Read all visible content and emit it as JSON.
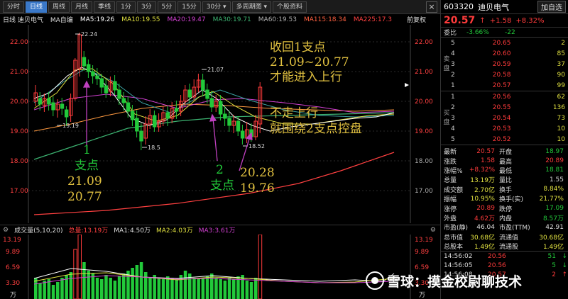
{
  "toolbar": {
    "buttons": [
      "分时",
      "日线",
      "周线",
      "月线",
      "季线",
      "1分",
      "3分",
      "5分",
      "15分",
      "30分 ▾",
      "多周期图 ▾",
      "个股资料"
    ],
    "active_index": 1,
    "close_label": "×"
  },
  "indicators": {
    "period": "日线 迪贝电气",
    "ma_label": "MA自编",
    "ma5": "MA5:19.26",
    "ma10": "MA10:19.55",
    "ma20": "MA20:19.47",
    "ma30": "MA30:19.71",
    "ma60": "MA60:19.53",
    "ma115": "MA115:18.34",
    "ma225": "MA225:17.3",
    "restore": "前复权"
  },
  "price_axis": [
    "22.00",
    "21.00",
    "20.00",
    "19.00",
    "18.00",
    "17.00"
  ],
  "price_axis_right": [
    "22.00",
    "21.00",
    "20.00",
    "19.00",
    "18.00",
    "17.00"
  ],
  "markers": {
    "high_peak": "22.24",
    "peak2": "21.07",
    "low1": "19.19",
    "low2": "18.5",
    "low3": "18.52"
  },
  "annotations": {
    "top_right": [
      "收回1支点",
      "21.09~20.77",
      "才能进入上行"
    ],
    "mid_right": [
      "不走上行",
      "就围绕2支点控盘"
    ],
    "sp1": [
      "1",
      "支点",
      "21.09",
      "20.77"
    ],
    "sp2_num": "2",
    "sp2_lbl": "支点",
    "sp2_vals": [
      "20.28",
      "19.76"
    ]
  },
  "volume": {
    "title": "成交量(5,10,20)",
    "total": "总量:13.19万",
    "ma1": "MA1:4.50万",
    "ma2": "MA2:4.03万",
    "ma3": "MA3:3.61万",
    "axis": [
      "13.19",
      "9.89",
      "6.59",
      "3.30",
      "万"
    ]
  },
  "right_panel": {
    "code": "603320",
    "name": "迪贝电气",
    "add_label": "加自选",
    "price": "20.57",
    "arrow": "↑",
    "change": "+1.58",
    "change_pct": "+8.32%",
    "weibi_label": "委比",
    "weibi_pct": "-3.66%",
    "weicha": "-22",
    "sell_label": "卖盘",
    "buy_label": "买盘",
    "sells": [
      {
        "n": "5",
        "p": "20.65",
        "v": "2"
      },
      {
        "n": "4",
        "p": "20.60",
        "v": "85"
      },
      {
        "n": "3",
        "p": "20.59",
        "v": "37"
      },
      {
        "n": "2",
        "p": "20.58",
        "v": "90"
      },
      {
        "n": "1",
        "p": "20.57",
        "v": "99"
      }
    ],
    "buys": [
      {
        "n": "1",
        "p": "20.56",
        "v": "62"
      },
      {
        "n": "2",
        "p": "20.55",
        "v": "136"
      },
      {
        "n": "3",
        "p": "20.54",
        "v": "73"
      },
      {
        "n": "4",
        "p": "20.53",
        "v": "10"
      },
      {
        "n": "5",
        "p": "20.52",
        "v": "10"
      }
    ],
    "stats": [
      {
        "l1": "最新",
        "v1": "20.57",
        "c1": "red",
        "l2": "开盘",
        "v2": "18.97",
        "c2": "green"
      },
      {
        "l1": "涨跌",
        "v1": "1.58",
        "c1": "red",
        "l2": "最高",
        "v2": "20.89",
        "c2": "red"
      },
      {
        "l1": "涨幅%",
        "v1": "+8.32%",
        "c1": "red",
        "l2": "最低",
        "v2": "18.81",
        "c2": "green"
      },
      {
        "l1": "总量",
        "v1": "13.19万",
        "c1": "yellow",
        "l2": "量比",
        "v2": "1.55",
        "c2": "white"
      },
      {
        "l1": "成交额",
        "v1": "2.70亿",
        "c1": "yellow",
        "l2": "换手",
        "v2": "8.84%",
        "c2": "yellow"
      },
      {
        "l1": "振幅",
        "v1": "10.95%",
        "c1": "yellow",
        "l2": "换手(实)",
        "v2": "21.77%",
        "c2": "yellow"
      },
      {
        "l1": "涨停",
        "v1": "20.89",
        "c1": "red",
        "l2": "跌停",
        "v2": "17.09",
        "c2": "green"
      },
      {
        "l1": "外盘",
        "v1": "4.62万",
        "c1": "red",
        "l2": "内盘",
        "v2": "8.57万",
        "c2": "green"
      },
      {
        "l1": "市盈(静)",
        "v1": "46.04",
        "c1": "white",
        "l2": "市盈(TTM)",
        "v2": "42.91",
        "c2": "white"
      },
      {
        "l1": "总市值",
        "v1": "30.68亿",
        "c1": "yellow",
        "l2": "流通值",
        "v2": "30.68亿",
        "c2": "yellow"
      },
      {
        "l1": "总股本",
        "v1": "1.49亿",
        "c1": "yellow",
        "l2": "流通股",
        "v2": "1.49亿",
        "c2": "yellow"
      }
    ],
    "ticks": [
      {
        "t": "14:56:02",
        "p": "20.56",
        "v": "51",
        "d": "↓"
      },
      {
        "t": "14:56:05",
        "p": "20.56",
        "v": "5",
        "d": "↓"
      },
      {
        "t": "14:56:08",
        "p": "20.57",
        "v": "2",
        "d": "↑"
      }
    ]
  },
  "watermark": {
    "text": "雪球：摸金校尉聊技术"
  },
  "colors": {
    "up": "#ff3b3b",
    "down": "#22c93a",
    "accent": "#3a78c8",
    "annotation": "#e0c040"
  }
}
